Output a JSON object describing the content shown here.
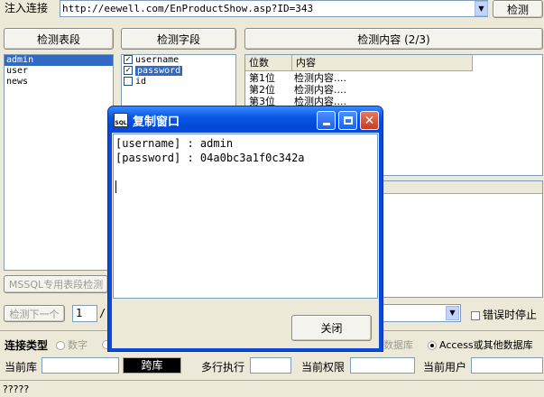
{
  "top": {
    "inject_label": "注入连接",
    "url": "http://eewell.com/EnProductShow.asp?ID=343",
    "detect_button": "检测"
  },
  "panels": {
    "tables_header": "检测表段",
    "fields_header": "检测字段",
    "content_header": "检测内容 (2/3)",
    "tables": [
      "admin",
      "user",
      "news"
    ],
    "fields": [
      {
        "name": "username",
        "checked": true
      },
      {
        "name": "password",
        "checked": true
      },
      {
        "name": "id",
        "checked": false
      }
    ],
    "content_columns": [
      "位数",
      "内容"
    ],
    "content_rows": [
      {
        "pos": "第1位",
        "text": "检测内容...."
      },
      {
        "pos": "第2位",
        "text": "检测内容...."
      },
      {
        "pos": "第3位",
        "text": "检测内容...."
      }
    ]
  },
  "mssql_button": "MSSQL专用表段检测",
  "next_button": "检测下一个",
  "page_value": "1",
  "page_sep": "/",
  "error_stop_label": "错误时停止",
  "conn": {
    "label": "连接类型",
    "radio_number": "数字",
    "radio_db": "数据库",
    "radio_access": "Access或其他数据库"
  },
  "bottom": {
    "current_db": "当前库",
    "cross_db": "跨库",
    "multi_exec": "多行执行",
    "current_perm": "当前权限",
    "current_user": "当前用户"
  },
  "status": "?????",
  "dialog": {
    "title": "复制窗口",
    "icon_text": "SQL",
    "lines": [
      "[username] : admin",
      "[password] : 04a0bc3a1f0c342a"
    ],
    "close_button": "关闭"
  }
}
